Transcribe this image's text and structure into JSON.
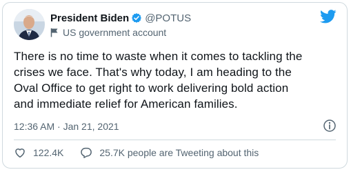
{
  "tweet": {
    "author": {
      "name": "President Biden",
      "handle": "@POTUS",
      "label": "US government account"
    },
    "text": "There is no time to waste when it comes to tackling the\ncrises we face. That's why today, I am heading to the\nOval Office to get right to work delivering bold action\nand immediate relief for American families.",
    "timestamp": "12:36 AM · Jan 21, 2021",
    "likes": "122.4K",
    "reply_text": "25.7K people are Tweeting about this"
  },
  "colors": {
    "brand": "#1d9bf0",
    "text": "#0f1419",
    "muted": "#536471",
    "border": "#cfd9de"
  },
  "icons": {
    "verified": "verified-badge-icon",
    "flag": "flag-icon",
    "logo": "twitter-bird-icon",
    "info": "info-icon",
    "like": "heart-icon",
    "reply": "speech-bubble-icon"
  }
}
